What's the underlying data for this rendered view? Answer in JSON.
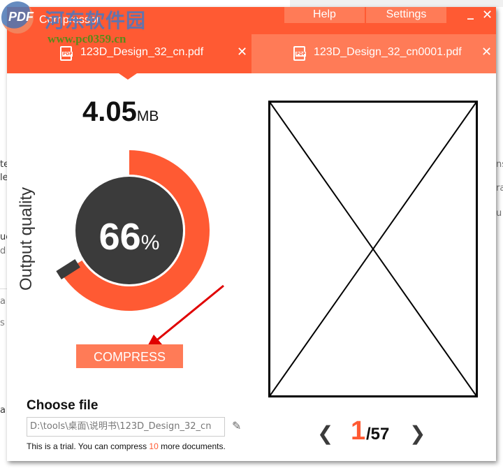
{
  "app": {
    "title": "PDF Compressor",
    "title_short": "Compressor",
    "logo_text": "PDF"
  },
  "watermark": {
    "site_name": "河东软件园",
    "url": "www.pc0359.cn"
  },
  "topbar": {
    "help_label": "Help",
    "settings_label": "Settings",
    "minimize_glyph": "_",
    "close_glyph": "✕"
  },
  "tabs": [
    {
      "label": "123D_Design_32_cn.pdf",
      "icon": "pdf-file-icon",
      "close_glyph": "✕",
      "active": true
    },
    {
      "label": "123D_Design_32_cn0001.pdf",
      "icon": "pdf-file-icon",
      "close_glyph": "✕",
      "active": false
    }
  ],
  "output": {
    "size_value": "4.05",
    "size_unit": "MB",
    "quality_label": "Output quality",
    "quality_value": "66",
    "quality_unit": "%",
    "quality_fraction": 0.66
  },
  "compress_label": "COMPRESS",
  "choose_file": {
    "title": "Choose file",
    "path_value": "D:\\tools\\桌面\\说明书\\123D_Design_32_cn",
    "edit_icon": "pencil-icon"
  },
  "trial": {
    "prefix": "This is a trial. You can compress ",
    "count": "10",
    "suffix": " more documents."
  },
  "pager": {
    "prev_glyph": "❮",
    "current": "1",
    "total": "/57",
    "next_glyph": "❯"
  },
  "background_fragments": {
    "left": [
      "te",
      "le",
      "ue",
      "d",
      "a",
      "s",
      "a"
    ],
    "right": [
      "ns",
      "ra",
      "u"
    ]
  },
  "colors": {
    "accent": "#ff5a33",
    "accent_light": "#ff7b57",
    "gauge_dark": "#3b3b3b",
    "arrow": "#e00000"
  }
}
